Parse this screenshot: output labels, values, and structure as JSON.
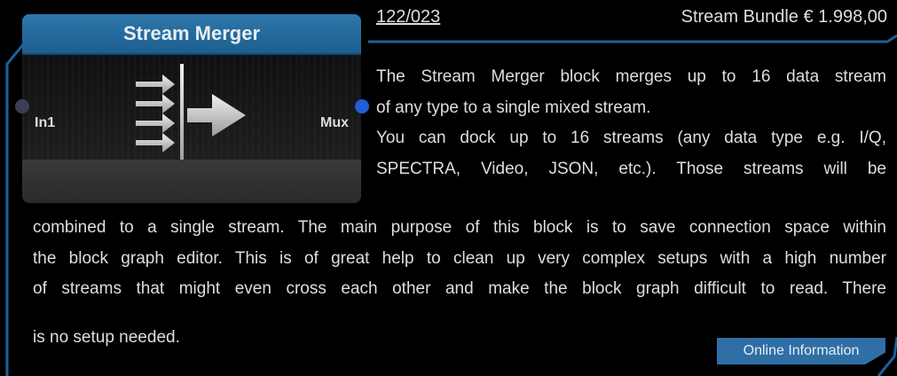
{
  "block": {
    "title": "Stream Merger",
    "input_port": "In1",
    "output_port": "Mux"
  },
  "header": {
    "item_number": "122/023",
    "bundle_price": "Stream Bundle € 1.998,00"
  },
  "description": {
    "lines_right": [
      "The Stream Merger block merges up to 16 data stream",
      "of any type to a single mixed stream.",
      "You can dock up to 16 streams (any data type e.g. I/Q,",
      "SPECTRA, Video, JSON, etc.). Those streams will be"
    ],
    "lines_full": [
      "combined to a single stream. The main purpose of this block is to save connection space within",
      "the block graph editor. This is of great help to clean up very complex setups with a high number",
      "of streams that might even cross each other and make the block graph difficult to read. There"
    ],
    "last_line": "is no setup needed."
  },
  "online_button": "Online Information",
  "colors": {
    "accent": "#2f77aa",
    "frame": "#1d5f9c",
    "output_port": "#1f5fd6",
    "input_port": "#3a3f52"
  },
  "icons": [
    "stream-merger-icon"
  ]
}
